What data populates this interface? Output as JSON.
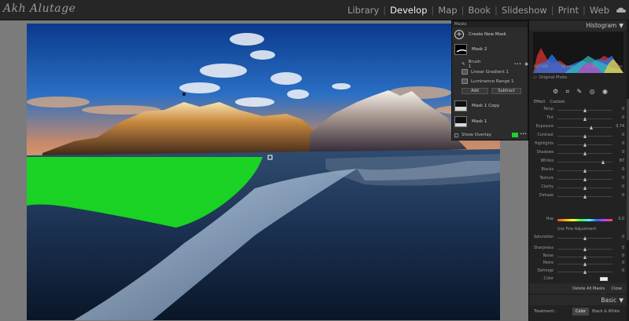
{
  "logo": "Akh Alutage",
  "nav": {
    "modules": [
      "Library",
      "Develop",
      "Map",
      "Book",
      "Slideshow",
      "Print",
      "Web"
    ],
    "active": "Develop"
  },
  "masks": {
    "header": "Masks",
    "create_label": "Create New Mask",
    "items": [
      {
        "name": "Mask 2"
      },
      {
        "name": "Brush 1"
      },
      {
        "name": "Linear Gradient 1"
      },
      {
        "name": "Luminance Range 1"
      },
      {
        "name": "Mask 1 Copy"
      },
      {
        "name": "Mask 1"
      }
    ],
    "add_label": "Add",
    "subtract_label": "Subtract",
    "show_overlay_label": "Show Overlay",
    "overlay_color": "#1bd12b"
  },
  "histogram": {
    "title": "Histogram",
    "iso": "ISO 100",
    "focal": "16 mm",
    "aperture": "f / 22",
    "shutter": "0.5 sec",
    "original_photo": "Original Photo"
  },
  "adjust": {
    "effect_label": "Effect",
    "effect_value": "Custom",
    "rows": [
      {
        "label": "Temp",
        "value": "0",
        "level": 0.5
      },
      {
        "label": "Tint",
        "value": "0",
        "level": 0.5
      },
      {
        "label": "Exposure",
        "value": "0.74",
        "level": 0.62
      },
      {
        "label": "Contrast",
        "value": "0",
        "level": 0.5
      },
      {
        "label": "Highlights",
        "value": "0",
        "level": 0.5
      },
      {
        "label": "Shadows",
        "value": "0",
        "level": 0.5
      },
      {
        "label": "Whites",
        "value": "87",
        "level": 0.84
      },
      {
        "label": "Blacks",
        "value": "0",
        "level": 0.5
      },
      {
        "label": "Texture",
        "value": "0",
        "level": 0.5
      },
      {
        "label": "Clarity",
        "value": "0",
        "level": 0.5
      },
      {
        "label": "Dehaze",
        "value": "0",
        "level": 0.5
      }
    ],
    "hue_label": "Hue",
    "hue_value": "0.0",
    "fine_adjust_label": "Use Fine Adjustment",
    "rows2": [
      {
        "label": "Saturation",
        "value": "0",
        "level": 0.5
      }
    ],
    "rows3": [
      {
        "label": "Sharpness",
        "value": "0",
        "level": 0.5
      },
      {
        "label": "Noise",
        "value": "0",
        "level": 0.5
      },
      {
        "label": "Moire",
        "value": "0",
        "level": 0.5
      },
      {
        "label": "Defringe",
        "value": "0",
        "level": 0.5
      }
    ],
    "color_label": "Color",
    "reset_label": "Reset Sliders Automatically"
  },
  "footer": {
    "delete_label": "Delete All Masks",
    "close_label": "Close"
  },
  "basic": {
    "title": "Basic",
    "treatment_label": "Treatment :",
    "options": [
      "Color",
      "Black & White"
    ],
    "selected": "Color"
  }
}
